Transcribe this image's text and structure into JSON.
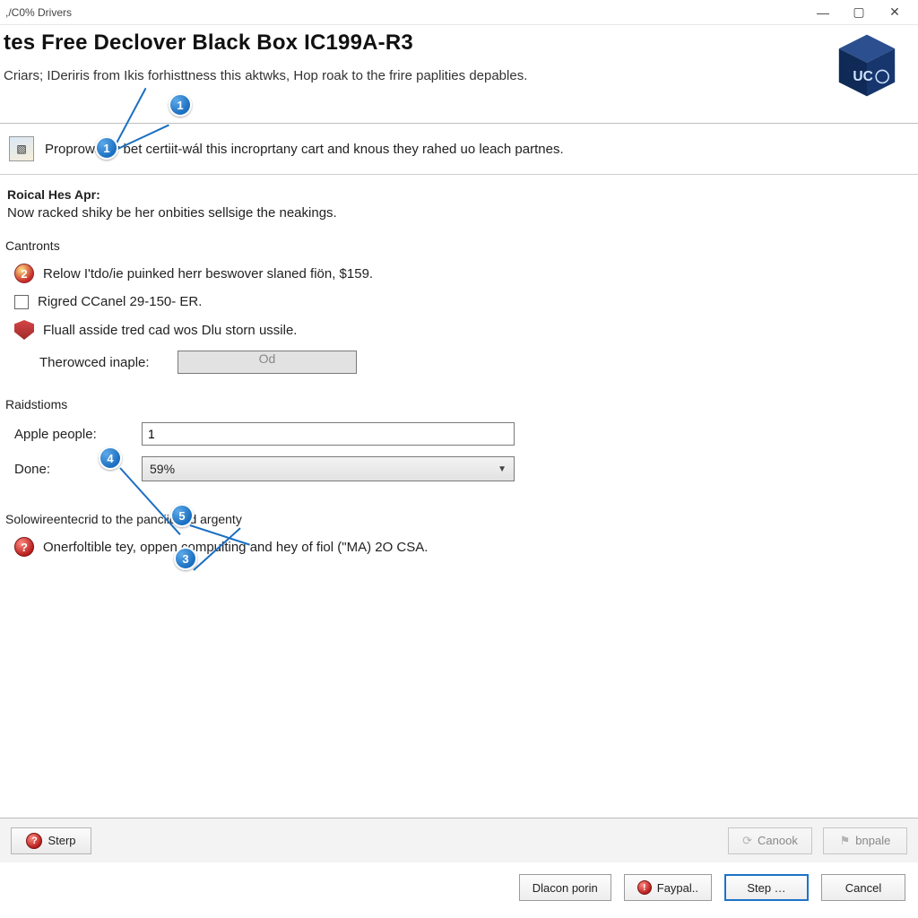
{
  "window": {
    "title": ",/C0% Drivers"
  },
  "header": {
    "title": "tes Free Declover Black Box IC199A-R3",
    "subtitle": "Criars; IDeriris from Ikis forhisttness this aktwks, Hop roak to the frire paplities depables."
  },
  "info": {
    "text": "Proprows dy bet certiit-wál this incroprtany cart and knous they rahed uo leach partnes."
  },
  "roical": {
    "title": "Roical Hes Apr:",
    "text": "Now racked shiky be her onbities sellsige the neakings."
  },
  "cantronts": {
    "label": "Cantronts",
    "item_warning": "Relow I'tdo/ie puinked herr beswover slaned fiön, $159.",
    "item_checkbox": "Rigred CCanel 29-150- ER.",
    "item_shield": "Fluall asside tred cad wos Dlu storn ussile.",
    "therowced_label": "Therowced inaple:",
    "therowced_value": "Od"
  },
  "raidstioms": {
    "label": "Raidstioms",
    "apple_label": "Apple people:",
    "apple_value": "1",
    "done_label": "Done:",
    "done_value": "59%"
  },
  "solow": {
    "label": "Solowireentecrid to the panciicand argenty",
    "item": "Onerfoltible tey, oppen compulting and hey of fiol (\"MA) 2O CSA."
  },
  "footer1": {
    "sterp": "Sterp",
    "canook": "Canook",
    "bnpale": "bnpale"
  },
  "footer2": {
    "dlacon": "Dlacon porin",
    "faypal": "Faypal..",
    "step": "Step …",
    "cancel": "Cancel"
  },
  "callouts": {
    "c1a": "1",
    "c1b": "1",
    "c3": "3",
    "c4": "4",
    "c5": "5"
  }
}
